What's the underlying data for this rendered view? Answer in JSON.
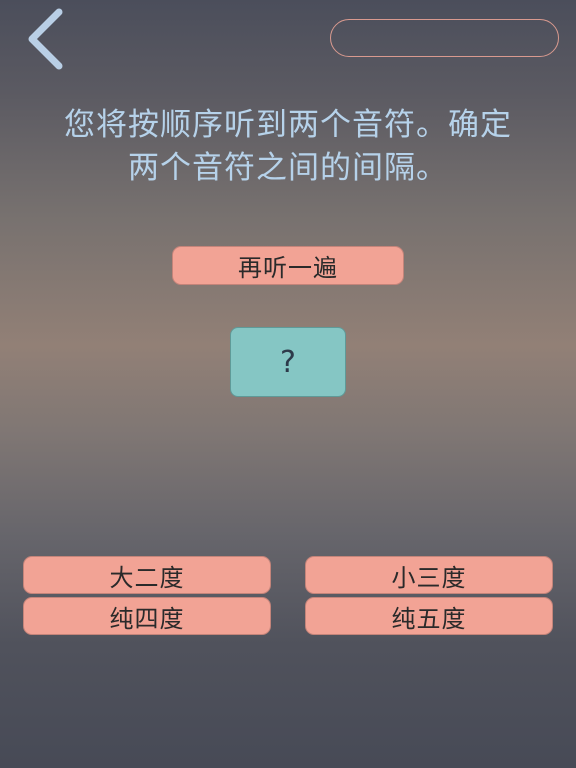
{
  "nav": {
    "back_icon": "chevron-left-icon"
  },
  "score": {
    "text": ""
  },
  "instructions": {
    "line1": "您将按顺序听到两个音符。确定",
    "line2": "两个音符之间的间隔。"
  },
  "replay_button": {
    "label": "再听一遍"
  },
  "note_card": {
    "symbol": "?"
  },
  "answers": [
    {
      "label": "大二度"
    },
    {
      "label": "小三度"
    },
    {
      "label": "纯四度"
    },
    {
      "label": "纯五度"
    }
  ],
  "colors": {
    "button_fill": "#f2a395",
    "note_card_fill": "#85c6c4",
    "instruction_text": "#b6d2ea",
    "back_icon": "#b9cfe6"
  }
}
